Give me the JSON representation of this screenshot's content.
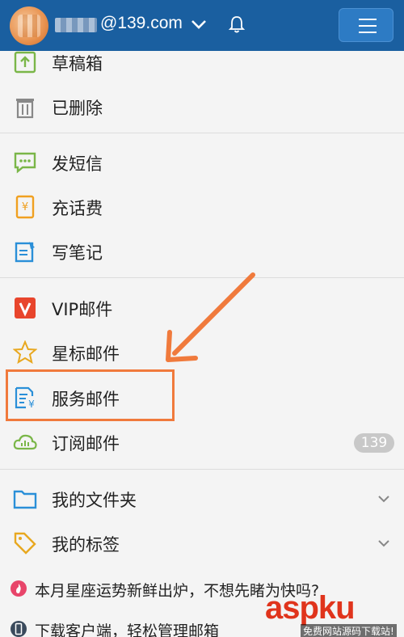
{
  "header": {
    "email": "@139.com"
  },
  "menu": {
    "drafts": "草稿箱",
    "deleted": "已删除",
    "send_sms": "发短信",
    "recharge": "充话费",
    "notes": "写笔记",
    "vip_mail": "VIP邮件",
    "starred_mail": "星标邮件",
    "service_mail": "服务邮件",
    "subscribed_mail": "订阅邮件",
    "subscribed_count": "139",
    "my_folders": "我的文件夹",
    "my_tags": "我的标签"
  },
  "promos": {
    "horoscope": "本月星座运势新鲜出炉，不想先睹为快吗?",
    "download": "下载客户端，轻松管理邮箱"
  },
  "watermark": {
    "brand": "aspku",
    "tagline": "免费网站源码下载站!"
  },
  "colors": {
    "header_bg": "#1a5fa0",
    "highlight": "#f07a3c",
    "sms_icon": "#7ab648",
    "recharge_icon": "#f0a020",
    "notes_icon": "#2a8fd8",
    "vip_icon": "#e8452c"
  }
}
